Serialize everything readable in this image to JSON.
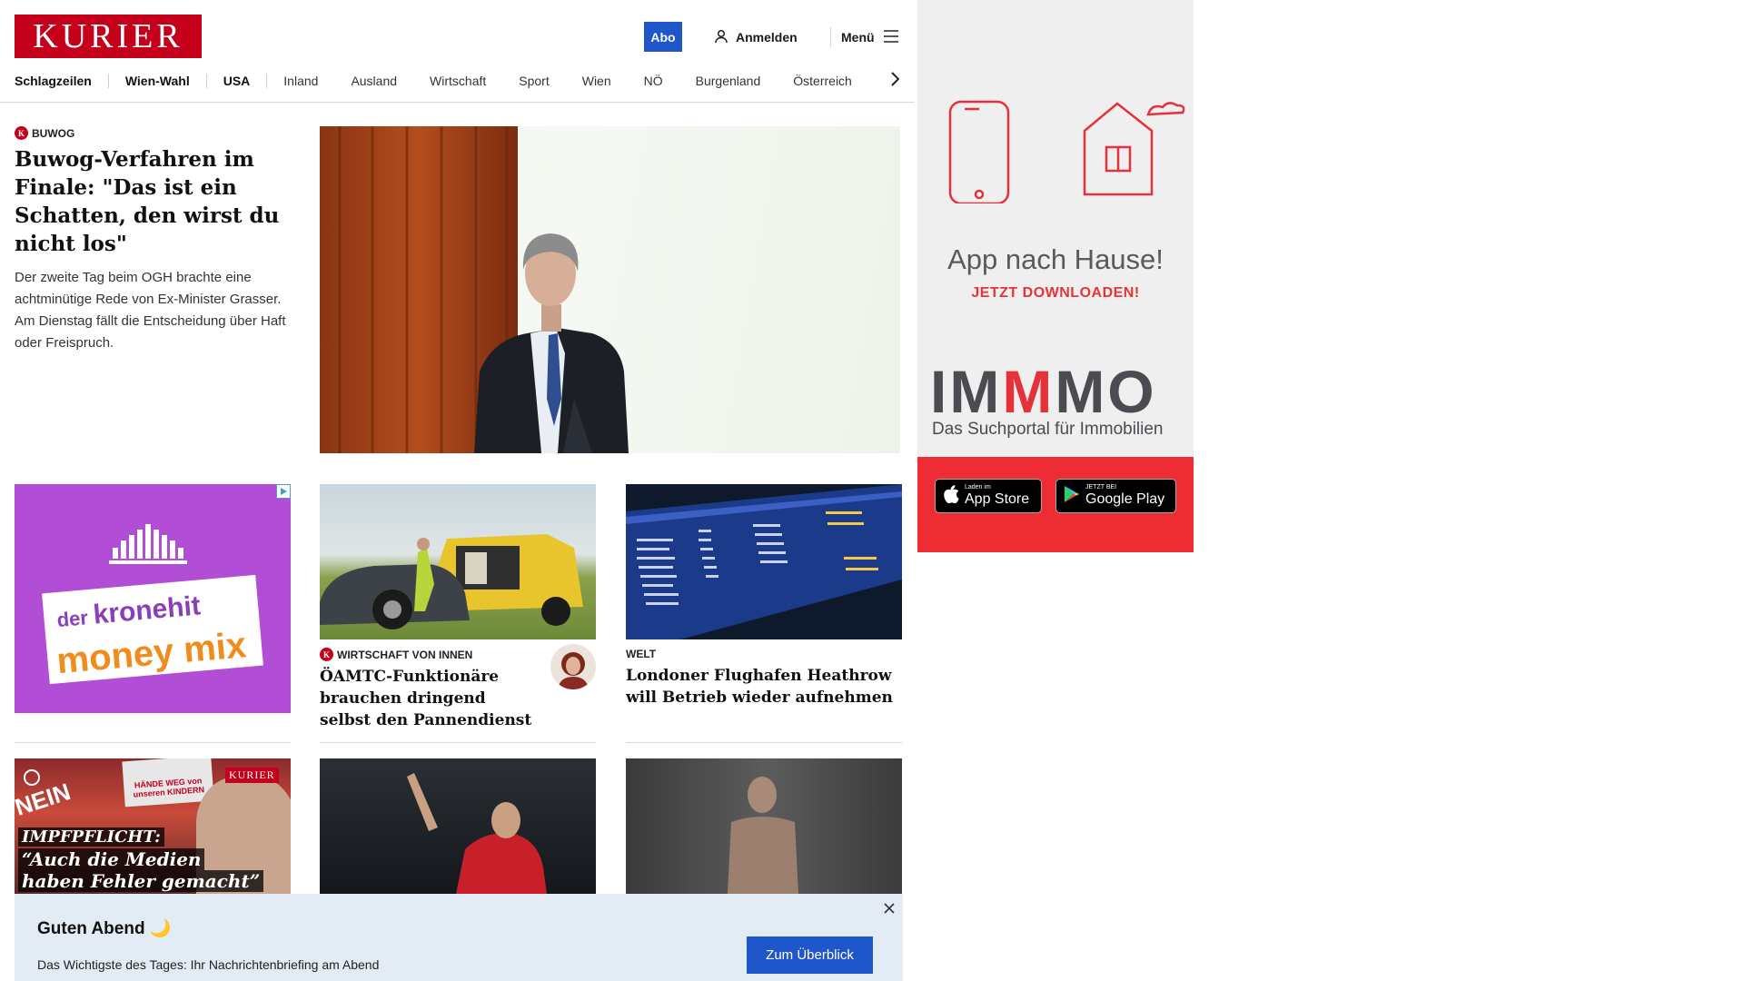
{
  "header": {
    "logo": "KURIER",
    "abo_label": "Abo",
    "login_label": "Anmelden",
    "menu_label": "Menü",
    "nav": [
      "Schlagzeilen",
      "Wien-Wahl",
      "USA",
      "Inland",
      "Ausland",
      "Wirtschaft",
      "Sport",
      "Wien",
      "NÖ",
      "Burgenland",
      "Österreich"
    ]
  },
  "hero": {
    "kicker": "BUWOG",
    "title": "Buwog-Verfahren im Finale: \"Das ist ein Schatten, den wirst du nicht los\"",
    "teaser": "Der zweite Tag beim OGH brachte eine achtminütige Rede von Ex-Minister Grasser. Am Dienstag fällt die Entscheidung über Haft oder Freispruch."
  },
  "ad": {
    "line1a": "der",
    "line1b": "kronehit",
    "line2": "money mix"
  },
  "cards": [
    {
      "kicker": "WIRTSCHAFT VON INNEN",
      "title": "ÖAMTC-Funktionäre brauchen dringend selbst den Pannendienst"
    },
    {
      "kicker": "WELT",
      "title": "Londoner Flughafen Heathrow will Betrieb wieder aufnehmen"
    }
  ],
  "video_card": {
    "brand": "KURIER",
    "line1": "IMPFPFLICHT:",
    "line2": "“Auch die Medien",
    "line3": "haben Fehler gemacht”",
    "sign_text": "HÄNDE WEG von unseren KINDERN",
    "banner": "NEIN"
  },
  "rail_ad": {
    "headline": "App nach Hause!",
    "cta": "JETZT DOWNLOADEN!",
    "brand_a": "IM",
    "brand_m": "M",
    "brand_b": "MO",
    "brand_sub": "Das Suchportal für Immobilien",
    "appstore_small": "Laden im",
    "appstore_big": "App Store",
    "play_small": "JETZT BEI",
    "play_big": "Google Play"
  },
  "briefing": {
    "title": "Guten Abend 🌙",
    "text": "Das Wichtigste des Tages: Ihr Nachrichtenbriefing am Abend",
    "button": "Zum Überblick"
  },
  "colors": {
    "brand_red": "#c4001a",
    "button_blue": "#1f56c9",
    "rail_red": "#ed2c34",
    "ad_purple": "#b24dd6"
  }
}
